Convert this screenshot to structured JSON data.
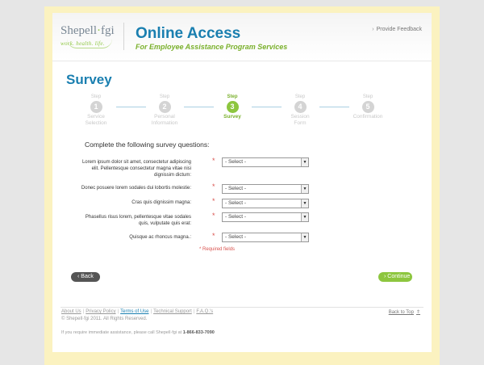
{
  "header": {
    "logo_name": "Shepell",
    "logo_dot": "·",
    "logo_brand": "fgi",
    "logo_tagline": "work. health. life.",
    "title": "Online Access",
    "subtitle": "For Employee Assistance Program Services",
    "feedback_link": "Provide Feedback"
  },
  "page_title": "Survey",
  "steps": [
    {
      "label": "Step",
      "number": "1",
      "name_line1": "Service",
      "name_line2": "Selection"
    },
    {
      "label": "Step",
      "number": "2",
      "name_line1": "Personal",
      "name_line2": "Information"
    },
    {
      "label": "Step",
      "number": "3",
      "name_line1": "Survey",
      "name_line2": ""
    },
    {
      "label": "Step",
      "number": "4",
      "name_line1": "Session",
      "name_line2": "Form"
    },
    {
      "label": "Step",
      "number": "5",
      "name_line1": "Confirmation",
      "name_line2": ""
    }
  ],
  "active_step": 3,
  "instructions": "Complete the following survey questions:",
  "questions": [
    {
      "line1": "Lorem ipsum dolor sit amet, consectetur adipiscing",
      "line2": "elit. Pellentesque consectetur magna vitae nisi",
      "line3": "dignissim dictum:",
      "value": "- Select -"
    },
    {
      "line1": "Donec posuere lorem sodales dui lobortis molestie:",
      "line2": "",
      "line3": "",
      "value": "- Select -"
    },
    {
      "line1": "Cras quis dignissim magna:",
      "line2": "",
      "line3": "",
      "value": "- Select -"
    },
    {
      "line1": "Phasellus risus lorem, pellentesque vitae sodales",
      "line2": "quis, vulputate quis erat:",
      "line3": "",
      "value": "- Select -"
    },
    {
      "line1": "Quisque ac rhoncus magna.:",
      "line2": "",
      "line3": "",
      "value": "- Select -"
    }
  ],
  "required_marker": "*",
  "required_note": "Required fields",
  "buttons": {
    "back": "Back",
    "continue": "Continue"
  },
  "footer": {
    "links": [
      "About Us",
      "Privacy Policy",
      "Terms of Use",
      "Technical Support",
      "F.A.Q.'s"
    ],
    "active_link": "Terms of Use",
    "copyright": "© Shepell·fgi 2011. All Rights Reserved.",
    "back_to_top": "Back to Top",
    "assist_text": "If you require immediate assistance, please call Shepell·fgi at",
    "assist_phone": "1-866-833-7090"
  },
  "colors": {
    "brand_blue": "#1a7fb0",
    "brand_green": "#8dc63f",
    "required_red": "#d9534f",
    "frame_yellow": "#fbf2c0"
  },
  "icons": {
    "feedback": "chevron-right-icon",
    "back": "chevron-left-icon",
    "continue": "chevron-right-icon",
    "back_to_top": "arrow-up-icon",
    "select": "caret-down-icon"
  }
}
